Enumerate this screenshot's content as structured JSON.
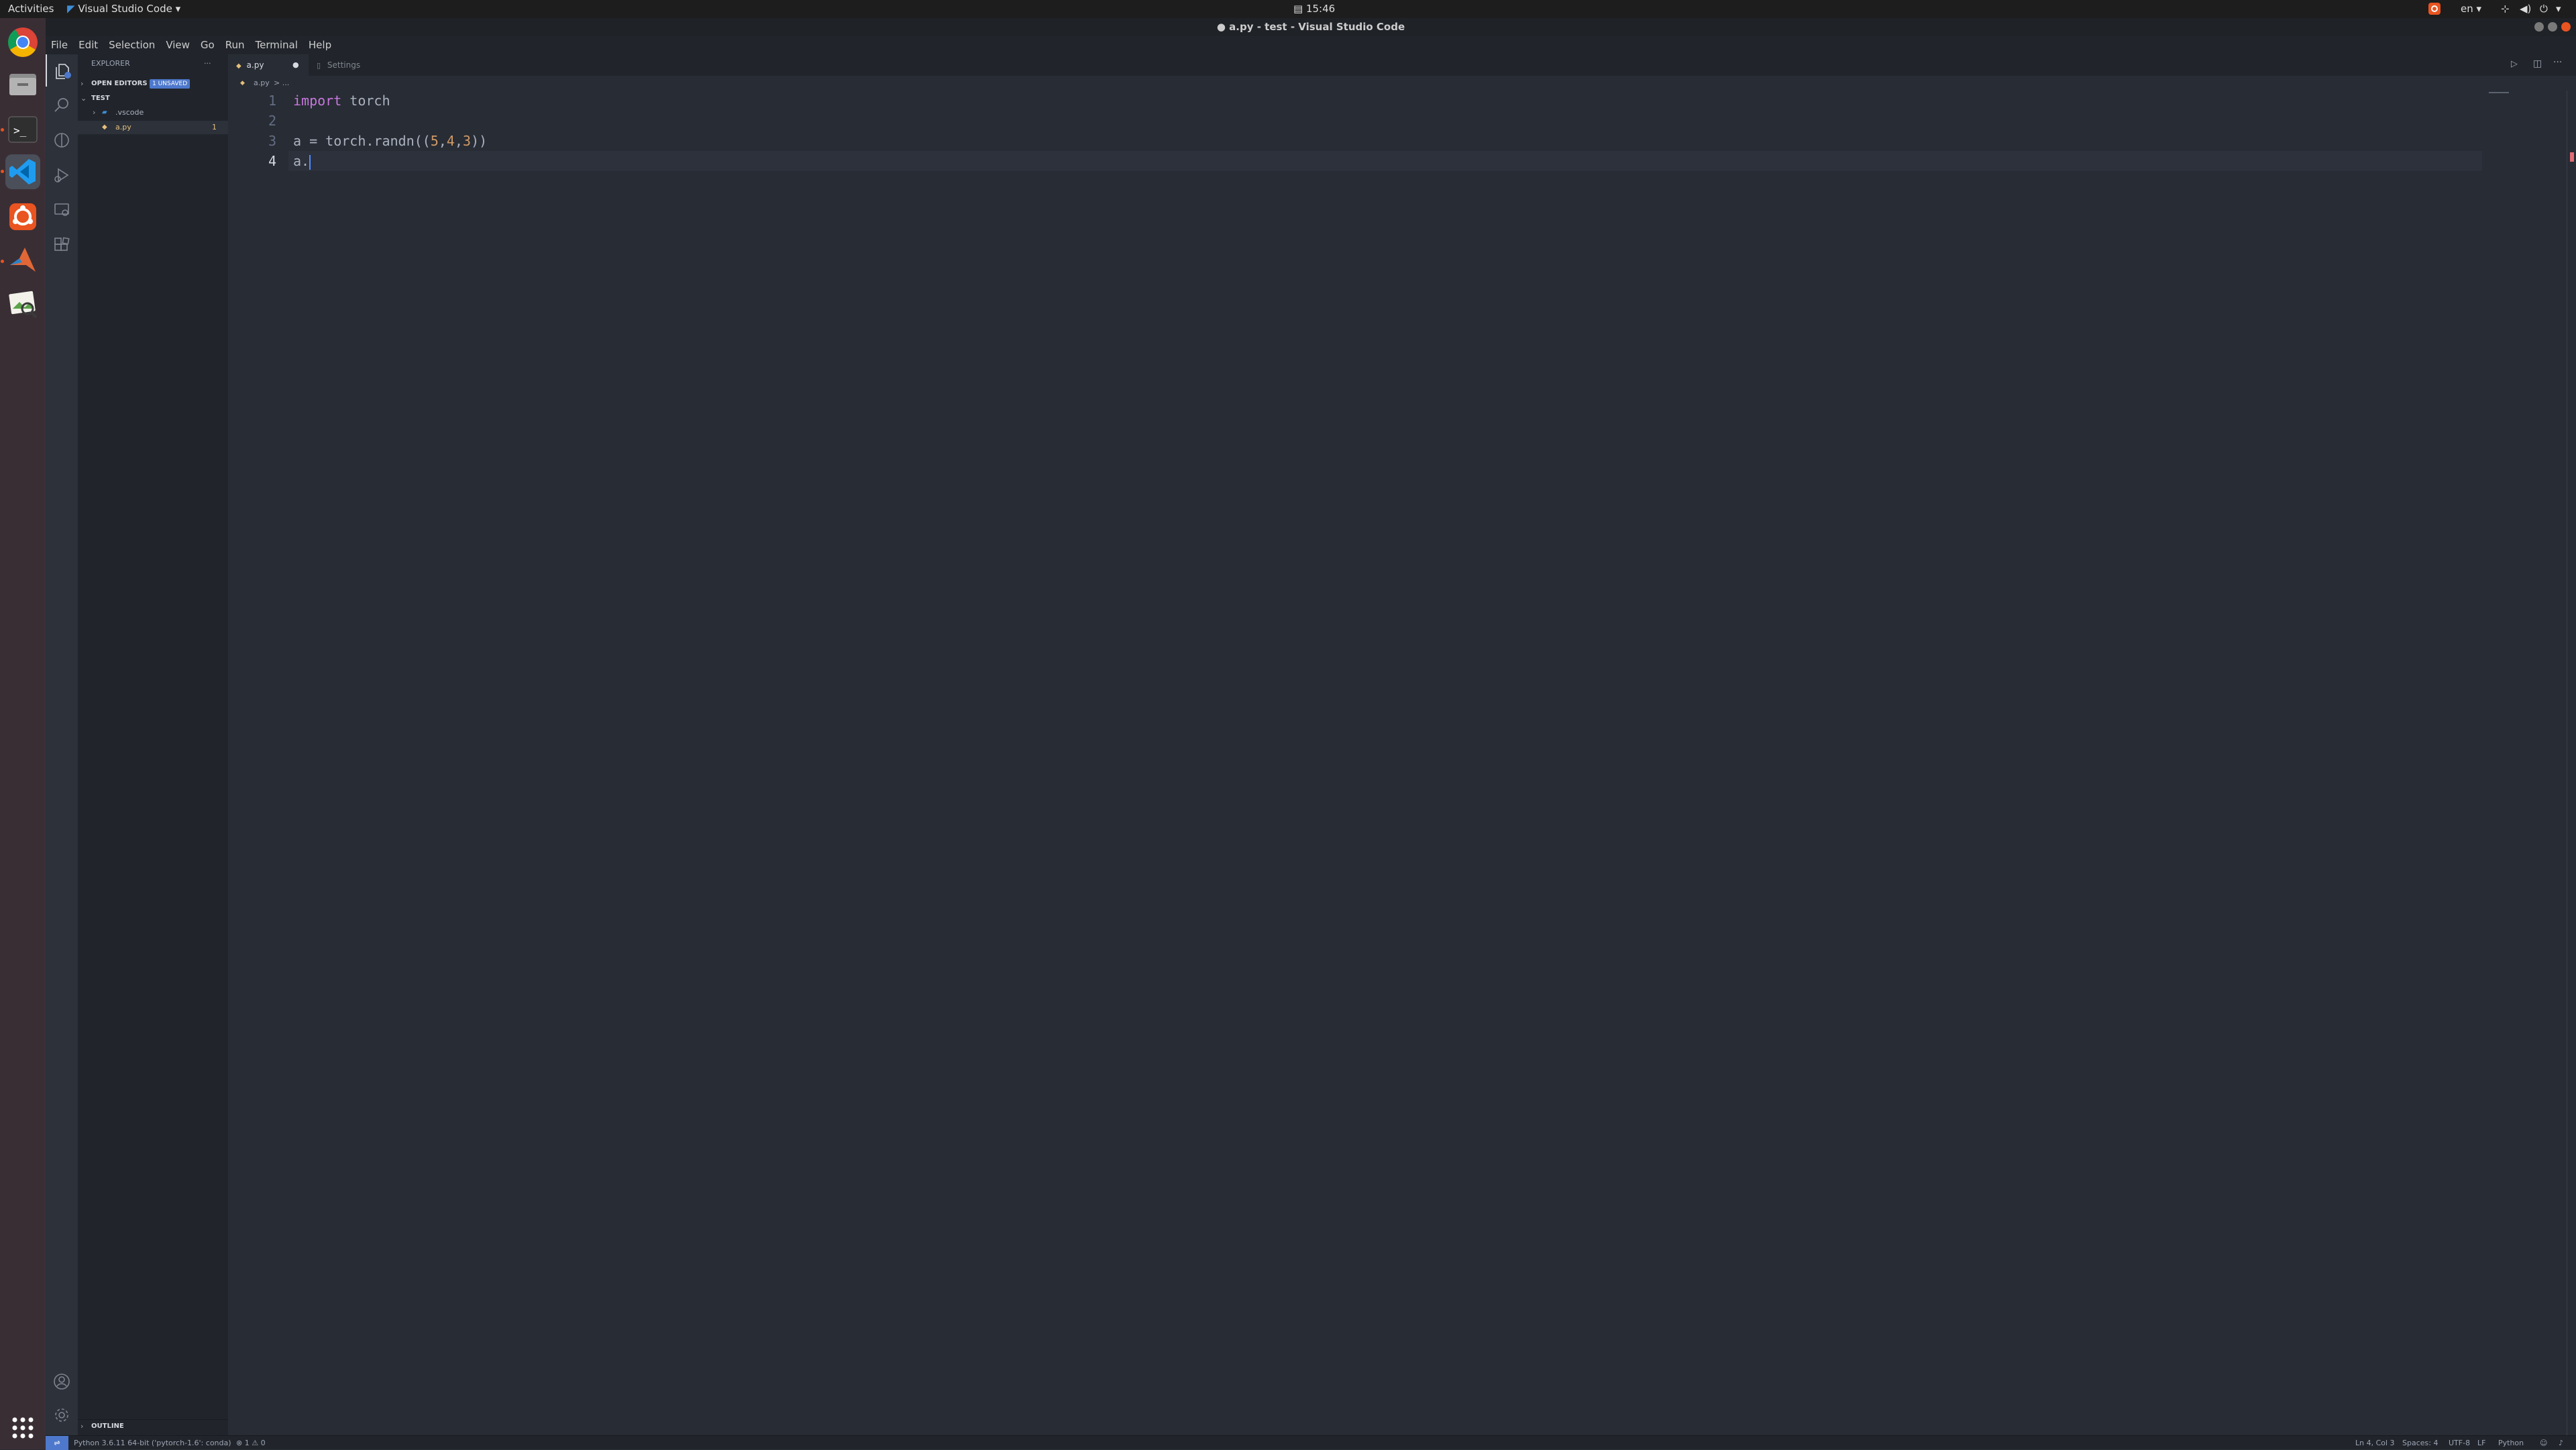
{
  "topbar": {
    "activities": "Activities",
    "app_menu": "Visual Studio Code",
    "clock": "15:46",
    "language": "en"
  },
  "window": {
    "title": "● a.py - test - Visual Studio Code"
  },
  "menu": [
    "File",
    "Edit",
    "Selection",
    "View",
    "Go",
    "Run",
    "Terminal",
    "Help"
  ],
  "sidebar": {
    "title": "EXPLORER",
    "more": "···",
    "open_editors": "OPEN EDITORS",
    "unsaved_badge": "1 UNSAVED",
    "folder": "TEST",
    "items": [
      {
        "label": ".vscode",
        "badge": ""
      },
      {
        "label": "a.py",
        "badge": "1"
      }
    ],
    "outline": "OUTLINE"
  },
  "tabs": [
    {
      "label": "a.py",
      "modified": "●"
    },
    {
      "label": "Settings",
      "modified": ""
    }
  ],
  "breadcrumb": {
    "file": "a.py",
    "rest": "> ..."
  },
  "editor": {
    "lines": [
      {
        "num": "1",
        "tokens": [
          {
            "text": "import",
            "kind": "kw"
          },
          {
            "text": " torch",
            "kind": "plain"
          }
        ]
      },
      {
        "num": "2",
        "tokens": []
      },
      {
        "num": "3",
        "tokens": [
          {
            "text": "a = torch.randn((",
            "kind": "plain"
          },
          {
            "text": "5",
            "kind": "num"
          },
          {
            "text": ",",
            "kind": "plain"
          },
          {
            "text": "4",
            "kind": "num"
          },
          {
            "text": ",",
            "kind": "plain"
          },
          {
            "text": "3",
            "kind": "num"
          },
          {
            "text": "))",
            "kind": "plain"
          }
        ]
      },
      {
        "num": "4",
        "tokens": [
          {
            "text": "a.",
            "kind": "plain"
          }
        ]
      }
    ],
    "current_line": 4
  },
  "statusbar": {
    "interpreter": "Python 3.6.11 64-bit ('pytorch-1.6': conda)",
    "errors": "1",
    "warnings": "0",
    "position": "Ln 4, Col 3",
    "spaces": "Spaces: 4",
    "encoding": "UTF-8",
    "eol": "LF",
    "language": "Python"
  },
  "colors": {
    "accent": "#4d78cc",
    "keyword": "#c678dd",
    "number": "#d19a66",
    "editor_bg": "#282c34"
  }
}
